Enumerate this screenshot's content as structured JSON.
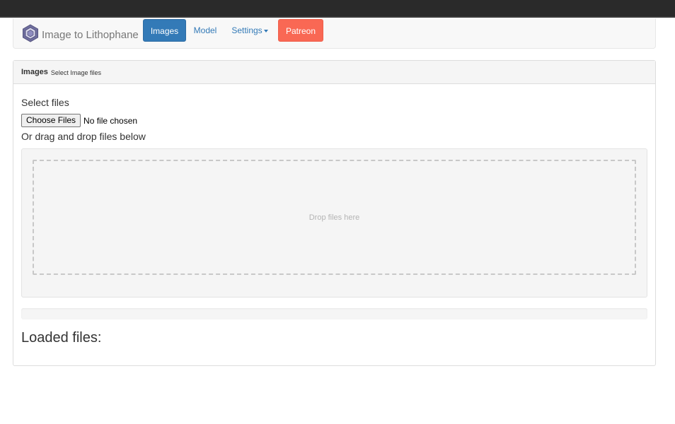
{
  "navbar": {
    "brand": "Image to Lithophane",
    "brand_icon": "hexagon-logo-icon",
    "items": [
      {
        "label": "Images",
        "active": true
      },
      {
        "label": "Model"
      },
      {
        "label": "Settings",
        "dropdown": true
      },
      {
        "label": "Patreon"
      }
    ]
  },
  "panel": {
    "title": "Images",
    "subtitle": "Select Image files",
    "select_files_label": "Select files",
    "choose_button": "Choose Files",
    "no_file_text": "No file chosen",
    "drag_label": "Or drag and drop files below",
    "drop_text": "Drop files here",
    "progress_fraction": 0,
    "loaded_files_title": "Loaded files:"
  },
  "colors": {
    "primary": "#337ab7",
    "patreon": "#f96854",
    "topbar": "#2a2a2a"
  }
}
